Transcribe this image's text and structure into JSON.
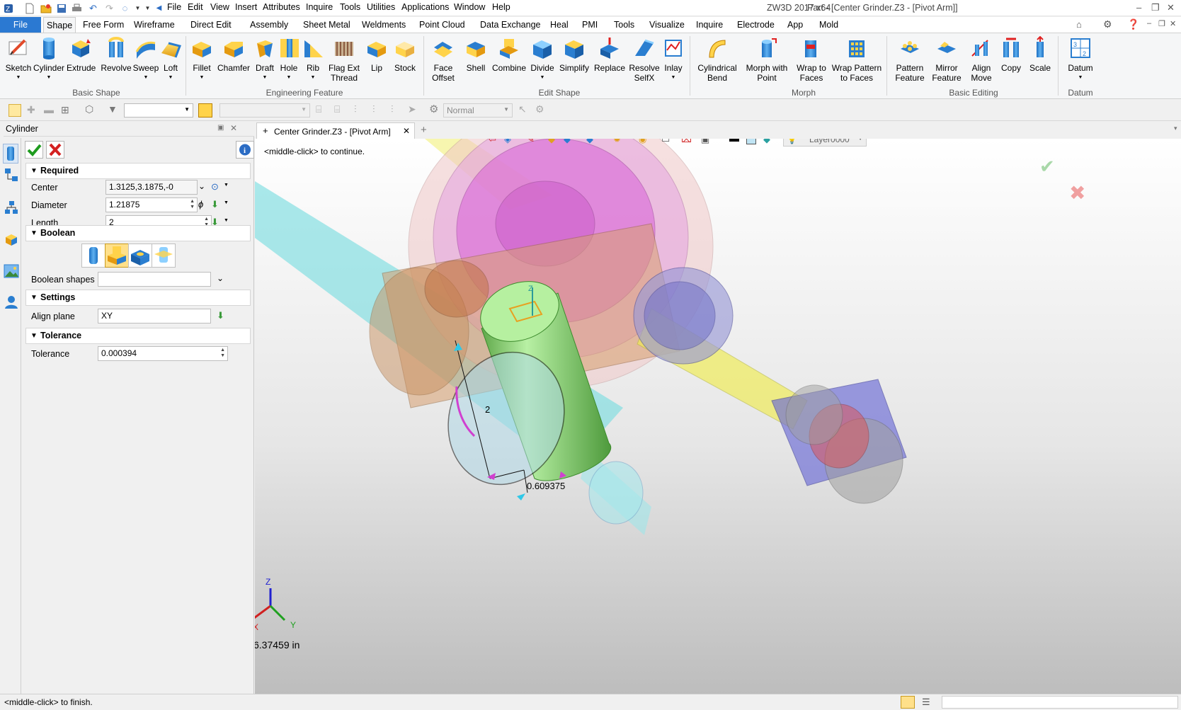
{
  "titlebar": {
    "app": "ZW3D 2017  x64",
    "doc": "Part - [Center Grinder.Z3 - [Pivot Arm]]",
    "menus": [
      "File",
      "Edit",
      "View",
      "Insert",
      "Attributes",
      "Inquire",
      "Tools",
      "Utilities",
      "Applications",
      "Window",
      "Help"
    ]
  },
  "ribbon": {
    "tabs": [
      "File",
      "Shape",
      "Free Form",
      "Wireframe",
      "Direct Edit",
      "Assembly",
      "Sheet Metal",
      "Weldments",
      "Point Cloud",
      "Data Exchange",
      "Heal",
      "PMI",
      "Tools",
      "Visualize",
      "Inquire",
      "Electrode",
      "App",
      "Mold"
    ],
    "active_tab": "Shape",
    "buttons": [
      "Sketch",
      "Cylinder",
      "Extrude",
      "Revolve",
      "Sweep",
      "Loft",
      "Fillet",
      "Chamfer",
      "Draft",
      "Hole",
      "Rib",
      "Flag Ext\nThread",
      "Lip",
      "Stock",
      "Face\nOffset",
      "Shell",
      "Combine",
      "Divide",
      "Simplify",
      "Replace",
      "Resolve\nSelfX",
      "Inlay",
      "Cylindrical\nBend",
      "Morph with\nPoint",
      "Wrap to\nFaces",
      "Wrap Pattern\nto Faces",
      "Pattern\nFeature",
      "Mirror\nFeature",
      "Align\nMove",
      "Copy",
      "Scale",
      "Datum"
    ],
    "groups": [
      "Basic Shape",
      "Engineering Feature",
      "Edit Shape",
      "Morph",
      "Basic Editing",
      "Datum"
    ]
  },
  "toolbar2": {
    "render_mode": "Normal"
  },
  "panel": {
    "title": "Cylinder",
    "sections": {
      "required": "Required",
      "boolean": "Boolean",
      "settings": "Settings",
      "tolerance": "Tolerance"
    },
    "fields": {
      "center_label": "Center",
      "center_value": "1.3125,3.1875,-0",
      "diameter_label": "Diameter",
      "diameter_value": "1.21875",
      "length_label": "Length",
      "length_value": "2",
      "boolean_shapes_label": "Boolean shapes",
      "boolean_shapes_value": "",
      "align_plane_label": "Align plane",
      "align_plane_value": "XY",
      "tolerance_label": "Tolerance",
      "tolerance_value": "0.000394"
    }
  },
  "viewport": {
    "doc_tab": "Center Grinder.Z3 - [Pivot Arm]",
    "prompt": "<middle-click> to continue.",
    "layer": "Layer0000",
    "dim_length": "2",
    "dim_diameter": "0.609375",
    "scale_readout": "6.37459 in",
    "axis": {
      "x": "X",
      "y": "Y",
      "z": "Z"
    }
  },
  "status": {
    "text": "<middle-click> to finish."
  },
  "colors": {
    "accent": "#2b79d2",
    "ok": "#1e9b1e",
    "cancel": "#d42020",
    "cylinder": "#8fd67a"
  }
}
